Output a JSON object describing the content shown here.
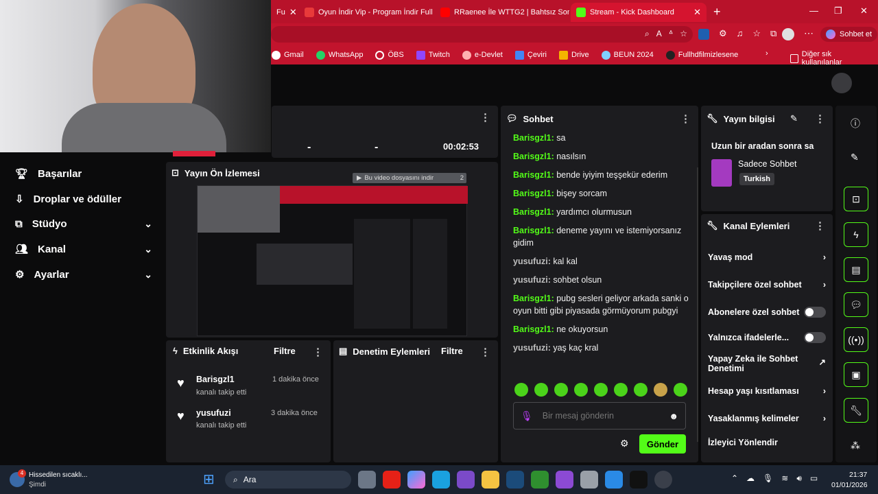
{
  "browser": {
    "tabs": [
      {
        "label": "Fu"
      },
      {
        "label": "Oyun İndir Vip - Program İndir Full"
      },
      {
        "label": "RRaenee İle WTTG2 | Bahtsız Son #"
      },
      {
        "label": "Stream - Kick Dashboard"
      }
    ],
    "copilot_label": "Sohbet et",
    "bookmarks": [
      "Gmail",
      "WhatsApp",
      "ÖBS",
      "Twitch",
      "e-Devlet",
      "Çeviri",
      "Drive",
      "BEUN 2024",
      "Fullhdfilmizlesene"
    ],
    "other_bookmarks": "Diğer sık kullanılanlar"
  },
  "stats": {
    "v1": "-",
    "v2": "-",
    "time": "00:02:53"
  },
  "sidebar": {
    "items": [
      {
        "label": "Başarılar"
      },
      {
        "label": "Droplar ve ödüller"
      },
      {
        "label": "Stüdyo"
      },
      {
        "label": "Kanal"
      },
      {
        "label": "Ayarlar"
      }
    ]
  },
  "preview": {
    "title": "Yayın Ön İzlemesi",
    "download_label": "Bu video dosyasını indir",
    "download_count": "2"
  },
  "activity": {
    "title": "Etkinlik Akışı",
    "filter": "Filtre",
    "events": [
      {
        "user": "Barisgzl1",
        "time": "1 dakika önce",
        "text": "kanalı takip etti"
      },
      {
        "user": "yusufuzi",
        "time": "3 dakika önce",
        "text": "kanalı takip etti"
      }
    ]
  },
  "moderation": {
    "title": "Denetim Eylemleri",
    "filter": "Filtre"
  },
  "chat": {
    "title": "Sohbet",
    "messages": [
      {
        "user": "Barisgzl1:",
        "text": "sa",
        "color": "#53fc18"
      },
      {
        "user": "Barisgzl1:",
        "text": "nasılsın",
        "color": "#53fc18"
      },
      {
        "user": "Barisgzl1:",
        "text": "bende iyiyim teşşekür ederim",
        "color": "#53fc18"
      },
      {
        "user": "Barisgzl1:",
        "text": "bişey sorcam",
        "color": "#53fc18"
      },
      {
        "user": "Barisgzl1:",
        "text": "yardımcı olurmusun",
        "color": "#53fc18"
      },
      {
        "user": "Barisgzl1:",
        "text": "deneme yayını ve istemiyorsanız gidim",
        "color": "#53fc18"
      },
      {
        "user": "yusufuzi:",
        "text": "kal kal",
        "color": "#bfbfbf"
      },
      {
        "user": "yusufuzi:",
        "text": "sohbet olsun",
        "color": "#bfbfbf"
      },
      {
        "user": "Barisgzl1:",
        "text": "pubg sesleri geliyor arkada sanki o oyun bitti gibi piyasada görmüyorum pubgyi",
        "color": "#53fc18"
      },
      {
        "user": "Barisgzl1:",
        "text": "ne okuyorsun",
        "color": "#53fc18"
      },
      {
        "user": "yusufuzi:",
        "text": "yaş kaç kral",
        "color": "#bfbfbf"
      }
    ],
    "placeholder": "Bir mesaj gönderin",
    "send": "Gönder"
  },
  "stream_info": {
    "title": "Yayın bilgisi",
    "stream_title": "Uzun bir aradan sonra sa",
    "category": "Sadece Sohbet",
    "tag": "Turkish"
  },
  "channel_actions": {
    "title": "Kanal Eylemleri",
    "items": [
      {
        "label": "Yavaş mod",
        "control": "chevron"
      },
      {
        "label": "Takipçilere özel sohbet",
        "control": "chevron"
      },
      {
        "label": "Abonelere özel sohbet",
        "control": "toggle"
      },
      {
        "label": "Yalnızca ifadelerle...",
        "control": "toggle"
      },
      {
        "label": "Yapay Zeka ile Sohbet Denetimi",
        "control": "external"
      },
      {
        "label": "Hesap yaşı kısıtlaması",
        "control": "chevron"
      },
      {
        "label": "Yasaklanmış kelimeler",
        "control": "chevron"
      },
      {
        "label": "İzleyici Yönlendir",
        "control": "none"
      }
    ]
  },
  "taskbar": {
    "weather": "Hissedilen sıcaklı...",
    "weather_sub": "Şimdi",
    "badge": "4",
    "search": "Ara",
    "time": "21:37",
    "date": "01/01/2026"
  },
  "colors": {
    "accent": "#53fc18",
    "chrome": "#c2142d"
  }
}
